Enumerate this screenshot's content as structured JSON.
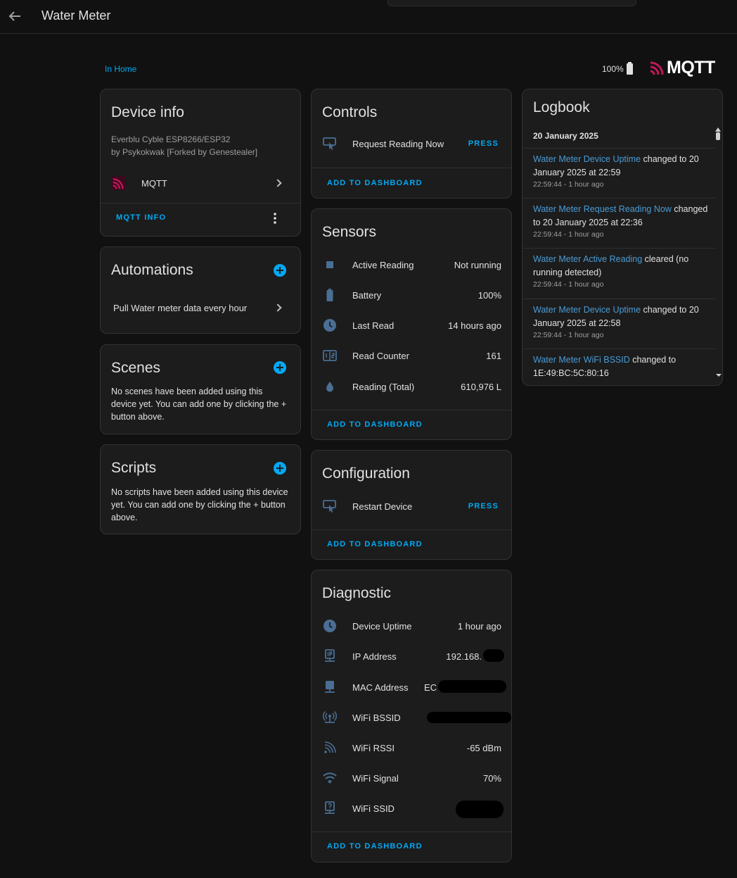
{
  "header": {
    "title": "Water Meter"
  },
  "breadcrumb": "In Home",
  "battery": {
    "label": "100%"
  },
  "brand": {
    "name": "MQTT",
    "color": "#c2185b"
  },
  "colors": {
    "accent": "#03a9f4",
    "card": "#1c1c1c",
    "background": "#111111",
    "icon": "#4a6e94",
    "link": "#4a9bd6"
  },
  "device_info": {
    "title": "Device info",
    "model": "Everblu Cyble ESP8266/ESP32",
    "manufacturer": "by Psykokwak [Forked by Genestealer]",
    "integration": "MQTT",
    "action": "MQTT INFO"
  },
  "automations": {
    "title": "Automations",
    "items": [
      "Pull Water meter data every hour"
    ]
  },
  "scenes": {
    "title": "Scenes",
    "empty": "No scenes have been added using this device yet. You can add one by clicking the + button above."
  },
  "scripts": {
    "title": "Scripts",
    "empty": "No scripts have been added using this device yet. You can add one by clicking the + button above."
  },
  "controls": {
    "title": "Controls",
    "items": [
      {
        "label": "Request Reading Now",
        "action": "PRESS",
        "icon": "button-press-icon"
      }
    ],
    "add": "ADD TO DASHBOARD"
  },
  "sensors": {
    "title": "Sensors",
    "items": [
      {
        "label": "Active Reading",
        "value": "Not running",
        "icon": "square-icon"
      },
      {
        "label": "Battery",
        "value": "100%",
        "icon": "battery-icon"
      },
      {
        "label": "Last Read",
        "value": "14 hours ago",
        "icon": "clock-icon"
      },
      {
        "label": "Read Counter",
        "value": "161",
        "icon": "counter-icon"
      },
      {
        "label": "Reading (Total)",
        "value": "610,976 L",
        "icon": "water-drop-icon"
      }
    ],
    "add": "ADD TO DASHBOARD"
  },
  "configuration": {
    "title": "Configuration",
    "items": [
      {
        "label": "Restart Device",
        "action": "PRESS",
        "icon": "button-press-icon"
      }
    ],
    "add": "ADD TO DASHBOARD"
  },
  "diagnostic": {
    "title": "Diagnostic",
    "items": [
      {
        "label": "Device Uptime",
        "value": "1 hour ago",
        "icon": "clock-icon"
      },
      {
        "label": "IP Address",
        "value": "192.168.",
        "icon": "ip-network-icon"
      },
      {
        "label": "MAC Address",
        "value": "EC",
        "icon": "network-icon"
      },
      {
        "label": "WiFi BSSID",
        "value": "",
        "icon": "access-point-icon"
      },
      {
        "label": "WiFi RSSI",
        "value": "-65 dBm",
        "icon": "signal-icon"
      },
      {
        "label": "WiFi Signal",
        "value": "70%",
        "icon": "wifi-icon"
      },
      {
        "label": "WiFi SSID",
        "value": "",
        "icon": "network-question-icon"
      }
    ],
    "add": "ADD TO DASHBOARD"
  },
  "logbook": {
    "title": "Logbook",
    "date": "20 January 2025",
    "entries": [
      {
        "name": "Water Meter Device Uptime",
        "text": " changed to 20 January 2025 at 22:59",
        "time": "22:59:44 - 1 hour ago"
      },
      {
        "name": "Water Meter Request Reading Now",
        "text": " changed to 20 January 2025 at 22:36",
        "time": "22:59:44 - 1 hour ago"
      },
      {
        "name": "Water Meter Active Reading",
        "text": " cleared (no running detected)",
        "time": "22:59:44 - 1 hour ago"
      },
      {
        "name": "Water Meter Device Uptime",
        "text": " changed to 20 January 2025 at 22:58",
        "time": "22:59:44 - 1 hour ago"
      },
      {
        "name": "Water Meter WiFi BSSID",
        "text": " changed to 1E:49:BC:5C:80:16",
        "time": ""
      }
    ]
  }
}
